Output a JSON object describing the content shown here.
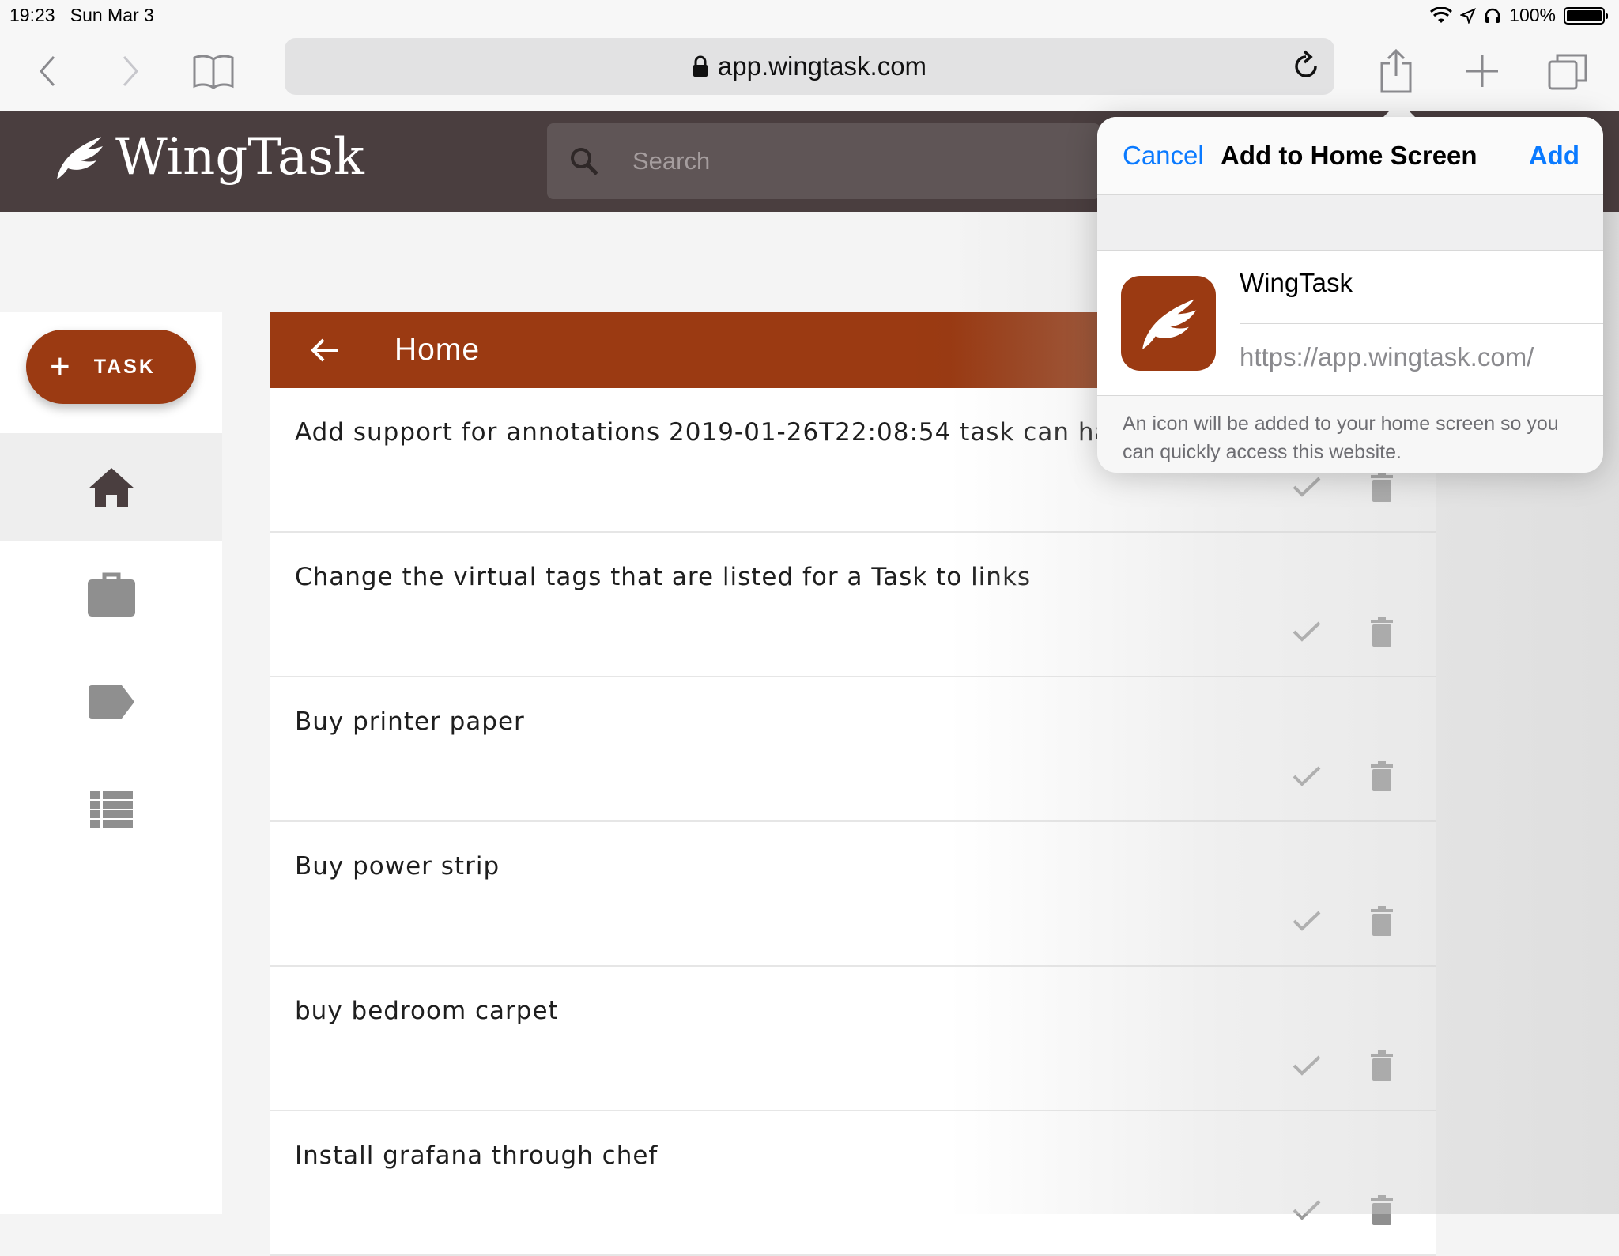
{
  "status_bar": {
    "time": "19:23",
    "date": "Sun Mar 3",
    "battery": "100%"
  },
  "browser": {
    "url": "app.wingtask.com"
  },
  "app": {
    "name": "WingTask",
    "search_placeholder": "Search"
  },
  "sidebar": {
    "fab_label": "TASK",
    "nav": [
      "home",
      "projects",
      "tags",
      "reports"
    ]
  },
  "main": {
    "title": "Home",
    "tasks": [
      "Add support for annotations 2019-01-26T22:08:54 task can have",
      "Change the virtual tags that are listed for a Task to links",
      "Buy printer paper",
      "Buy power strip",
      "buy bedroom carpet",
      "Install grafana through chef"
    ]
  },
  "popover": {
    "cancel": "Cancel",
    "title": "Add to Home Screen",
    "add": "Add",
    "app_name": "WingTask",
    "app_url": "https://app.wingtask.com/",
    "note": "An icon will be added to your home screen so you can quickly access this website."
  },
  "colors": {
    "brand": "#9b3a12",
    "header": "#4a3e3f",
    "ios_blue": "#0a7aff"
  }
}
